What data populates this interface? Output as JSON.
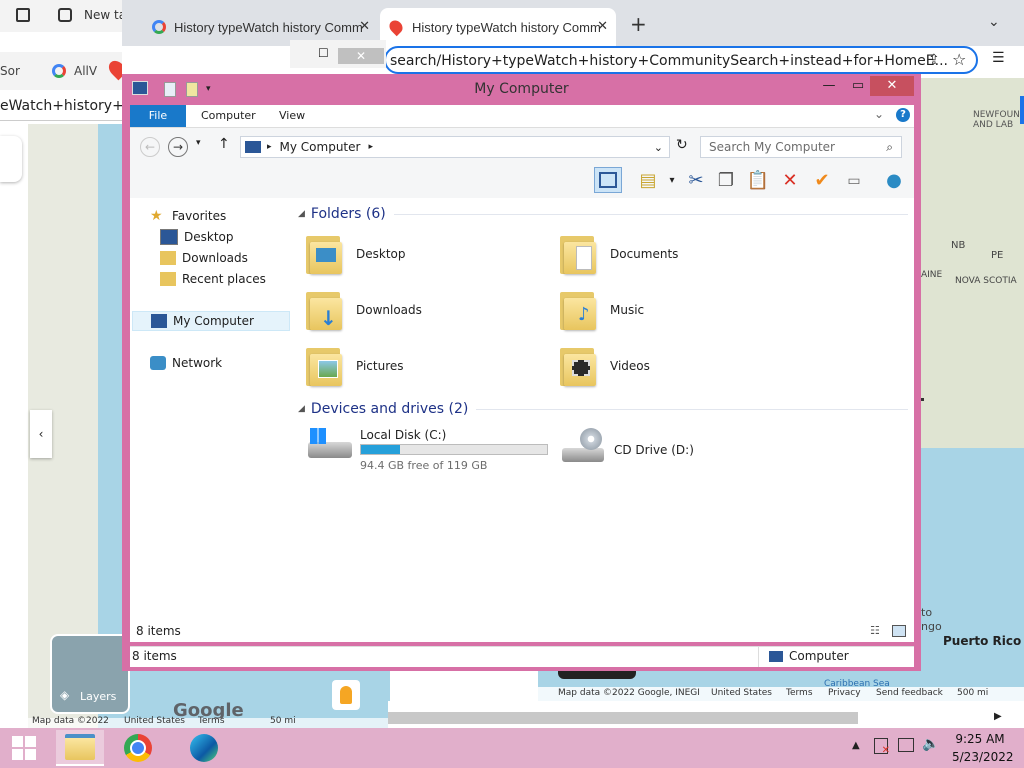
{
  "browser_bg": {
    "left_tab_label": "New ta",
    "left_tabs_row2": [
      "Sor",
      "AllV"
    ],
    "left_address_fragment": "eWatch+history+Co",
    "tabs": [
      {
        "label": "History typeWatch history Comm"
      },
      {
        "label": "History typeWatch history Comm"
      }
    ],
    "address": "search/History+typeWatch+history+CommunitySearch+instead+for+HomeE...",
    "map_labels": {
      "newfoundland": "NEWFOUN AND LAB",
      "nb": "NB",
      "pe": "PE",
      "maine": "AINE",
      "nova_scotia": "NOVA SCOTIA",
      "puerto_rico": "Puerto Rico",
      "caribbean": "Caribbean Sea",
      "to": "to",
      "ngo": "ngo"
    },
    "map_footer": [
      "Map data ©2022 Google, INEGI",
      "United States",
      "Terms",
      "Privacy",
      "Send feedback",
      "500 mi"
    ],
    "left_map_footer": [
      "Map data ©2022",
      "United States",
      "Terms",
      "50 mi"
    ],
    "layers_label": "Layers",
    "google_logo": "Google"
  },
  "explorer": {
    "title": "My Computer",
    "ribbon_tabs": [
      "File",
      "Computer",
      "View"
    ],
    "address_text": "My Computer",
    "search_placeholder": "Search My Computer",
    "sidebar": {
      "favorites": "Favorites",
      "desktop": "Desktop",
      "downloads": "Downloads",
      "recent": "Recent places",
      "my_computer": "My Computer",
      "network": "Network"
    },
    "folders_header": "Folders (6)",
    "folders": [
      "Desktop",
      "Documents",
      "Downloads",
      "Music",
      "Pictures",
      "Videos"
    ],
    "devices_header": "Devices and drives (2)",
    "drives": [
      {
        "name": "Local Disk (C:)",
        "free_text": "94.4 GB free of 119 GB",
        "used_fraction": 0.21
      },
      {
        "name": "CD Drive (D:)"
      }
    ],
    "items_count": "8 items",
    "status_left": "8 items",
    "status_right": "Computer"
  },
  "taskbar": {
    "time": "9:25 AM",
    "date": "5/23/2022"
  },
  "colors": {
    "window_frame": "#d770a6",
    "taskbar": "#e1afcb",
    "file_tab": "#1979ca",
    "drive_bar": "#26a0da"
  }
}
